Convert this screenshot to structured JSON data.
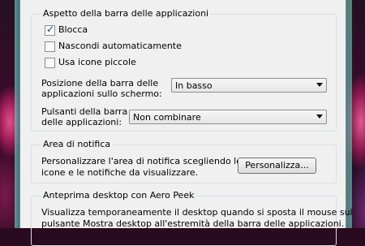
{
  "taskbar_appearance": {
    "title": "Aspetto della barra delle applicazioni",
    "lock": {
      "label": "Blocca",
      "checked": true
    },
    "autohide": {
      "label": "Nascondi automaticamente",
      "checked": false
    },
    "small_icons": {
      "label": "Usa icone piccole",
      "checked": false
    },
    "position": {
      "label_line1": "Posizione della barra delle",
      "label_line2": "applicazioni sullo schermo:",
      "value": "In basso"
    },
    "buttons": {
      "label_line1": "Pulsanti della barra",
      "label_line2": "delle applicazioni:",
      "value": "Non combinare"
    }
  },
  "notification_area": {
    "title": "Area di notifica",
    "text_line1": "Personalizzare l'area di notifica scegliendo le",
    "text_line2": "icone e le notifiche da visualizzare.",
    "customize_label": "Personalizza..."
  },
  "aero_peek": {
    "title": "Anteprima desktop con Aero Peek",
    "text_line1": "Visualizza temporaneamente il desktop quando si sposta il mouse sul",
    "text_line2": "pulsante Mostra desktop all'estremità della barra delle applicazioni."
  }
}
